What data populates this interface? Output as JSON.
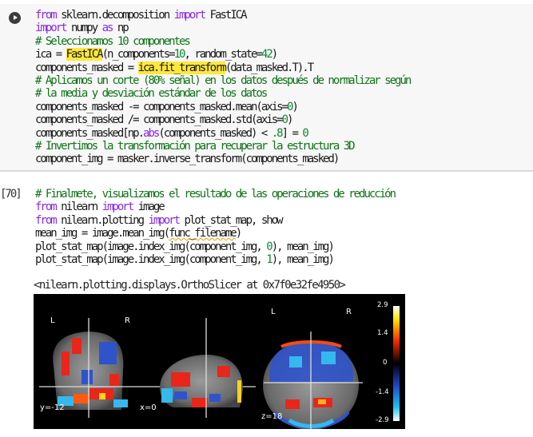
{
  "cell1": {
    "lines": [
      [
        [
          "kw",
          "from"
        ],
        [
          "t",
          " sklearn.decomposition "
        ],
        [
          "kw",
          "import"
        ],
        [
          "t",
          " FastICA"
        ]
      ],
      [
        [
          "kw",
          "import"
        ],
        [
          "t",
          " numpy "
        ],
        [
          "kw",
          "as"
        ],
        [
          "t",
          " np"
        ]
      ],
      [
        [
          "cm",
          "# Seleccionamos 10 componentes"
        ]
      ],
      [
        [
          "t",
          "ica = "
        ],
        [
          "hl",
          "FastICA"
        ],
        [
          "t",
          "(n_components="
        ],
        [
          "num",
          "10"
        ],
        [
          "t",
          ", random_state="
        ],
        [
          "num",
          "42"
        ],
        [
          "t",
          ")"
        ]
      ],
      [
        [
          "t",
          "components_masked = "
        ],
        [
          "hl",
          "ica.fit_transform"
        ],
        [
          "t",
          "(data_masked.T).T"
        ]
      ],
      [
        [
          "cm",
          "# Aplicamos un corte (80% señal) en los datos después de normalizar según"
        ]
      ],
      [
        [
          "cm",
          "# la media y desviación estándar de los datos"
        ]
      ],
      [
        [
          "t",
          "components_masked -= components_masked.mean(axis="
        ],
        [
          "num",
          "0"
        ],
        [
          "t",
          ")"
        ]
      ],
      [
        [
          "t",
          "components_masked /= components_masked.std(axis="
        ],
        [
          "num",
          "0"
        ],
        [
          "t",
          ")"
        ]
      ],
      [
        [
          "t",
          "components_masked[np."
        ],
        [
          "kw",
          "abs"
        ],
        [
          "t",
          "(components_masked) < "
        ],
        [
          "num",
          ".8"
        ],
        [
          "t",
          "] = "
        ],
        [
          "num",
          "0"
        ]
      ],
      [
        [
          "cm",
          "# Invertimos la transformación para recuperar la estructura 3D"
        ]
      ],
      [
        [
          "t",
          "component_img = masker.inverse_transform(components_masked)"
        ]
      ]
    ]
  },
  "cell2": {
    "exec_count": "[70]",
    "lines": [
      [
        [
          "cm",
          "# Finalmete, visualizamos el resultado de las operaciones de reducción"
        ]
      ],
      [
        [
          "kw",
          "from"
        ],
        [
          "t",
          " nilearn "
        ],
        [
          "kw",
          "import"
        ],
        [
          "t",
          " image"
        ]
      ],
      [
        [
          "kw",
          "from"
        ],
        [
          "t",
          " nilearn.plotting "
        ],
        [
          "kw",
          "import"
        ],
        [
          "t",
          " plot_stat_map, show"
        ]
      ],
      [
        [
          "t",
          "mean_img = image.mean_img("
        ],
        [
          "sq",
          "func_filename"
        ],
        [
          "t",
          ")"
        ]
      ],
      [
        [
          "t",
          "plot_stat_map(image.index_img(component_img, "
        ],
        [
          "num",
          "0"
        ],
        [
          "t",
          "), mean_img)"
        ]
      ],
      [
        [
          "t",
          "plot_stat_map(image.index_img(component_img, "
        ],
        [
          "num",
          "1"
        ],
        [
          "t",
          "), mean_img)"
        ]
      ]
    ]
  },
  "output": {
    "repr": "<nilearn.plotting.displays.OrthoSlicer at 0x7f0e32fe4950>",
    "figure": {
      "coronal": {
        "left": "L",
        "right": "R",
        "coord": "y=-12"
      },
      "sagittal": {
        "coord": "x=0"
      },
      "axial": {
        "left": "L",
        "right": "R",
        "coord": "z=18"
      },
      "colorbar": {
        "ticks": [
          "2.9",
          "1.4",
          "0",
          "-1.4",
          "-2.9"
        ],
        "max": 2.9,
        "min": -2.9
      }
    }
  },
  "colors": {
    "keyword": "#8a2be2",
    "comment": "#11741a",
    "highlight": "#ffe83a",
    "cell_bg": "#f7f7f7"
  }
}
